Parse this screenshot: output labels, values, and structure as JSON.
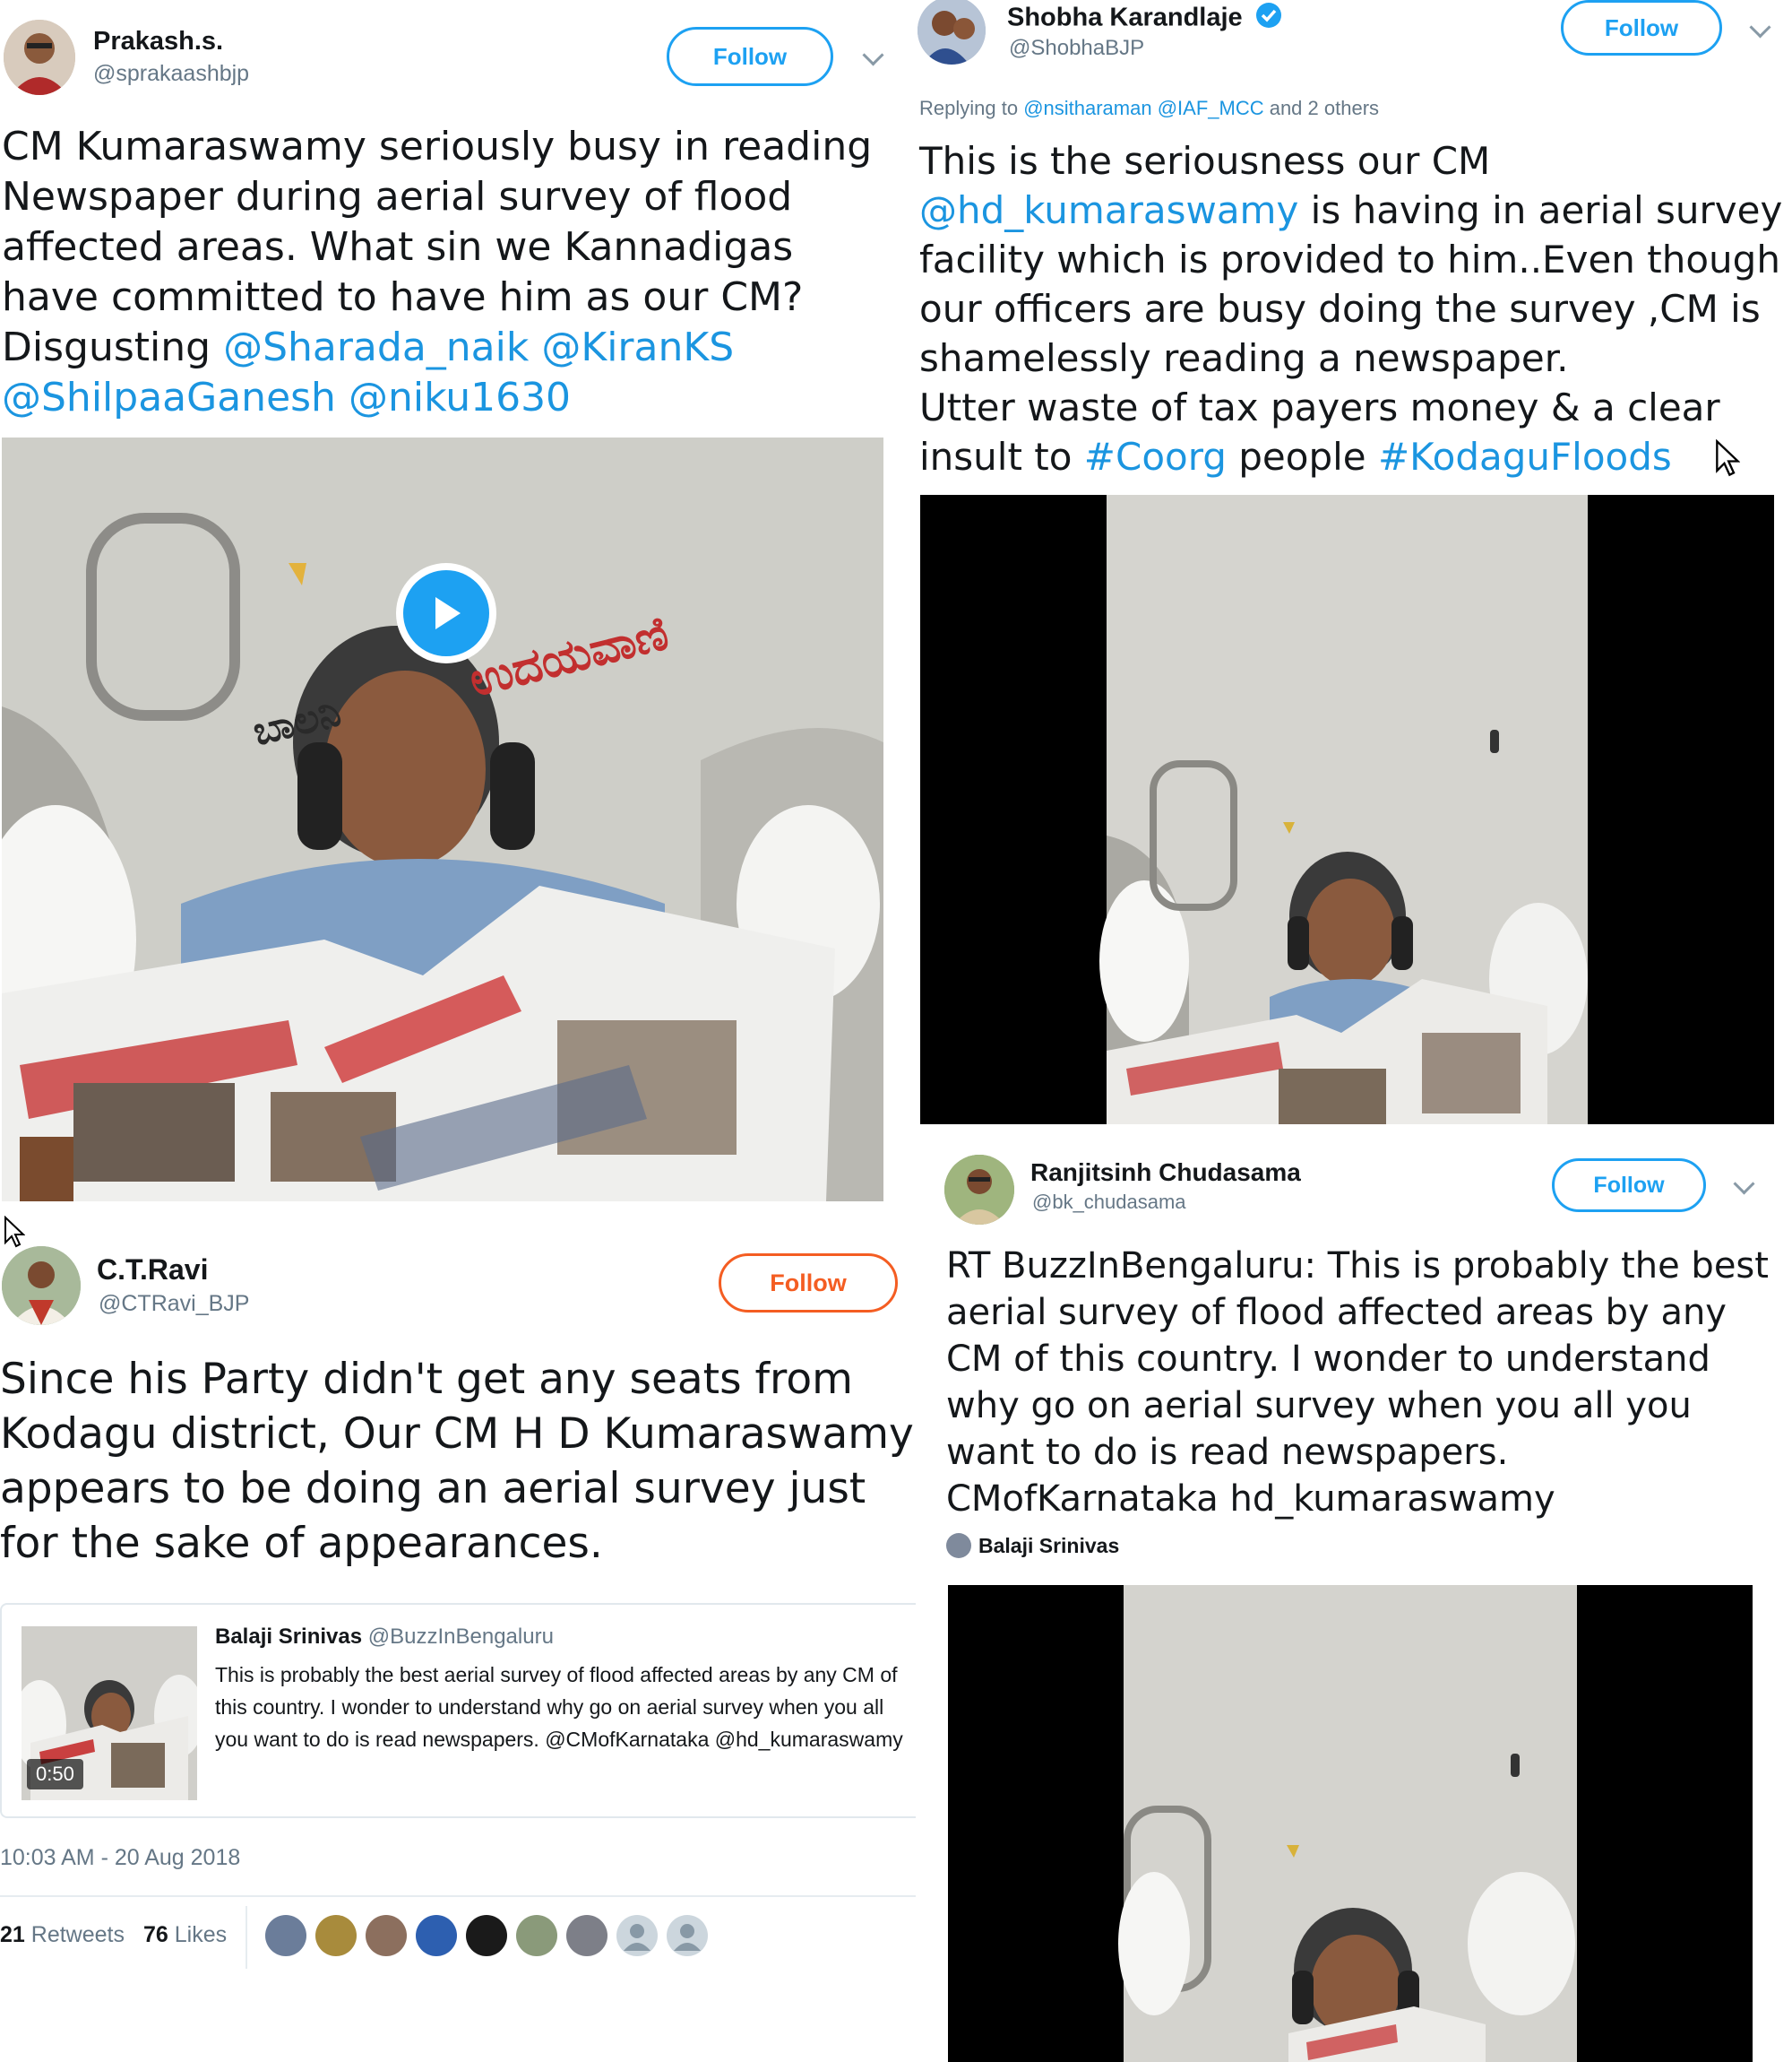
{
  "tweet1": {
    "name": "Prakash.s.",
    "handle": "@sprakaashbjp",
    "follow": "Follow",
    "text_plain": "CM Kumaraswamy seriously busy in reading Newspaper during aerial survey of flood affected areas. What sin we Kannadigas have committed to have him as our CM? Disgusting ",
    "mentions": [
      "@Sharada_naik",
      "@KiranKS",
      "@ShilpaaGanesh",
      "@niku1630"
    ],
    "paper_title": "ಉದಯವಾಣಿ",
    "paper_section": "ಬಾಲನಿ"
  },
  "tweet2": {
    "name": "Shobha Karandlaje",
    "handle": "@ShobhaBJP",
    "follow": "Follow",
    "replying_prefix": "Replying to ",
    "replying_users": "@nsitharaman @IAF_MCC",
    "replying_suffix": " and 2 others",
    "text_1": "This is the seriousness our CM ",
    "mention": "@hd_kumaraswamy",
    "text_2": " is having in aerial survey facility which is provided to him..Even though our officers are busy doing the survey ,CM is shamelessly reading a newspaper.",
    "text_3": "Utter waste of tax payers money & a clear insult to ",
    "hashtag_1": "#Coorg",
    "text_4": " people ",
    "hashtag_2": "#KodaguFloods"
  },
  "tweet3": {
    "name": "C.T.Ravi",
    "handle": "@CTRavi_BJP",
    "follow": "Follow",
    "text": "Since his Party didn't get any seats from Kodagu district, Our CM H D Kumaraswamy appears to be doing an aerial survey just for the sake of appearances.",
    "quote": {
      "name": "Balaji Srinivas",
      "handle": "@BuzzInBengaluru",
      "text": "This is probably the best aerial survey of flood affected areas by any CM of this country. I wonder to understand why go on aerial survey when you all you want to do is read newspapers. @CMofKarnataka @hd_kumaraswamy",
      "duration": "0:50"
    },
    "timestamp": "10:03 AM - 20 Aug 2018",
    "retweets_count": "21",
    "retweets_label": "Retweets",
    "likes_count": "76",
    "likes_label": "Likes"
  },
  "tweet4": {
    "name": "Ranjitsinh Chudasama",
    "handle": "@bk_chudasama",
    "follow": "Follow",
    "text": "RT BuzzInBengaluru: This is probably the best aerial survey of flood affected areas by any CM of this country. I wonder to understand why go on aerial survey when you all you want to do is read newspapers. CMofKarnataka hd_kumaraswamy",
    "credit": "Balaji Srinivas"
  },
  "colors": {
    "link_blue": "#1b95e0",
    "follow_blue": "#1da1f2",
    "follow_orange": "#f45d22",
    "play_blue": "#1da1f2"
  }
}
